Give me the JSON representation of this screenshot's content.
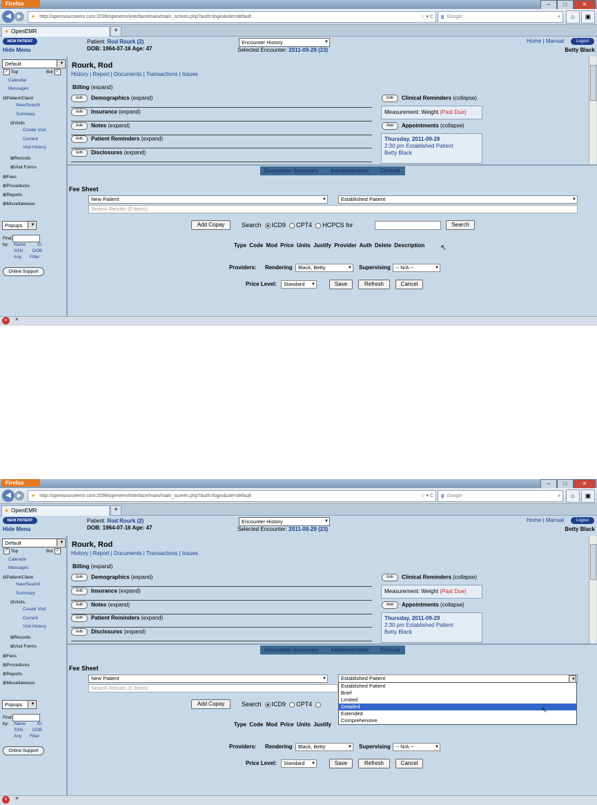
{
  "browser": {
    "menu_button": "Firefox",
    "url": "http://opensourceemr.com:2099/openemr/interface/main/main_screen.php?auth=login&site=default",
    "search_engine": "Google",
    "tab_title": "OpenEMR",
    "new_tab": "+"
  },
  "header": {
    "new_patient": "NEW PATIENT",
    "hide_menu": "Hide Menu",
    "patient_label": "Patient:",
    "patient_name": "Rod Rourk (2)",
    "dob_age": "DOB: 1964-07-16 Age: 47",
    "encounter_history": "Encounter History",
    "selected_encounter_label": "Selected Encounter:",
    "selected_encounter": "2011-09-29 (23)",
    "home": "Home",
    "sep": "|",
    "manual": "Manual",
    "logout": "Logout",
    "user": "Betty Black"
  },
  "leftnav": {
    "default_select": "Default",
    "top": "Top",
    "bot": "Bot",
    "items": [
      "Calendar",
      "Messages",
      "Patient/Client",
      "New/Search",
      "Summary",
      "Visits",
      "Create Visit",
      "Current",
      "Visit History",
      "Records",
      "Visit Forms",
      "Fees",
      "Procedures",
      "Reports",
      "Miscellaneous"
    ],
    "popups": "Popups",
    "find": "Find:",
    "by": "by:",
    "find_name": "Name",
    "find_id": "ID",
    "find_ssn": "SSN",
    "find_dob": "DOB",
    "find_any": "Any",
    "find_filter": "Filter",
    "online_support": "Online Support"
  },
  "summary": {
    "name": "Rourk, Rod",
    "links": "History | Report | Documents | Transactions | Issues",
    "billing": "Billing",
    "expand": "(expand)",
    "collapse": "(collapse)",
    "edit": "Edit",
    "add": "Add",
    "sections": [
      "Demographics",
      "Insurance",
      "Notes",
      "Patient Reminders",
      "Disclosures"
    ],
    "clinical_reminders": "Clinical Reminders",
    "measurement": "Measurement: Weight",
    "past_due": "(Past Due)",
    "appointments": "Appointments",
    "appt_date": "Thursday, 2011-09-29",
    "appt_time": "2:30 pm Established Patient",
    "appt_provider": "Betty Black"
  },
  "encounter_tabs": [
    "Encounter Summary",
    "Administrative",
    "Clinical"
  ],
  "fee_sheet": {
    "title": "Fee Sheet",
    "new_patient_select": "New Patient",
    "established_select": "Established Patient",
    "search_results": "Search Results (0 items)",
    "add_copay": "Add Copay",
    "search_label": "Search",
    "icd9": "ICD9",
    "cpt4": "CPT4",
    "hcpcs": "HCPCS",
    "for": "for",
    "search_button": "Search",
    "columns": "Type Code Mod Price Units Justify Provider Auth Delete Description",
    "columns_partial": "Type Code Mod Price Units Justify",
    "providers_label": "Providers:",
    "rendering_label": "Rendering",
    "rendering_value": "Black, Betty",
    "supervising_label": "Supervising",
    "supervising_value": "-- N/A --",
    "price_level_label": "Price Level:",
    "price_level_value": "Standard",
    "save": "Save",
    "refresh": "Refresh",
    "cancel": "Cancel"
  },
  "dropdown_options": [
    "Established Patient",
    "Brief",
    "Limited",
    "Detailed",
    "Extended",
    "Comprehensive"
  ],
  "dropdown_highlighted": "Detailed",
  "statusbar": {
    "close": "×"
  },
  "colors": {
    "nav_blue": "#1d3f8d",
    "panel": "#c7d9e8",
    "past_due": "#d02020",
    "enc_bar": "#3d6a92"
  }
}
